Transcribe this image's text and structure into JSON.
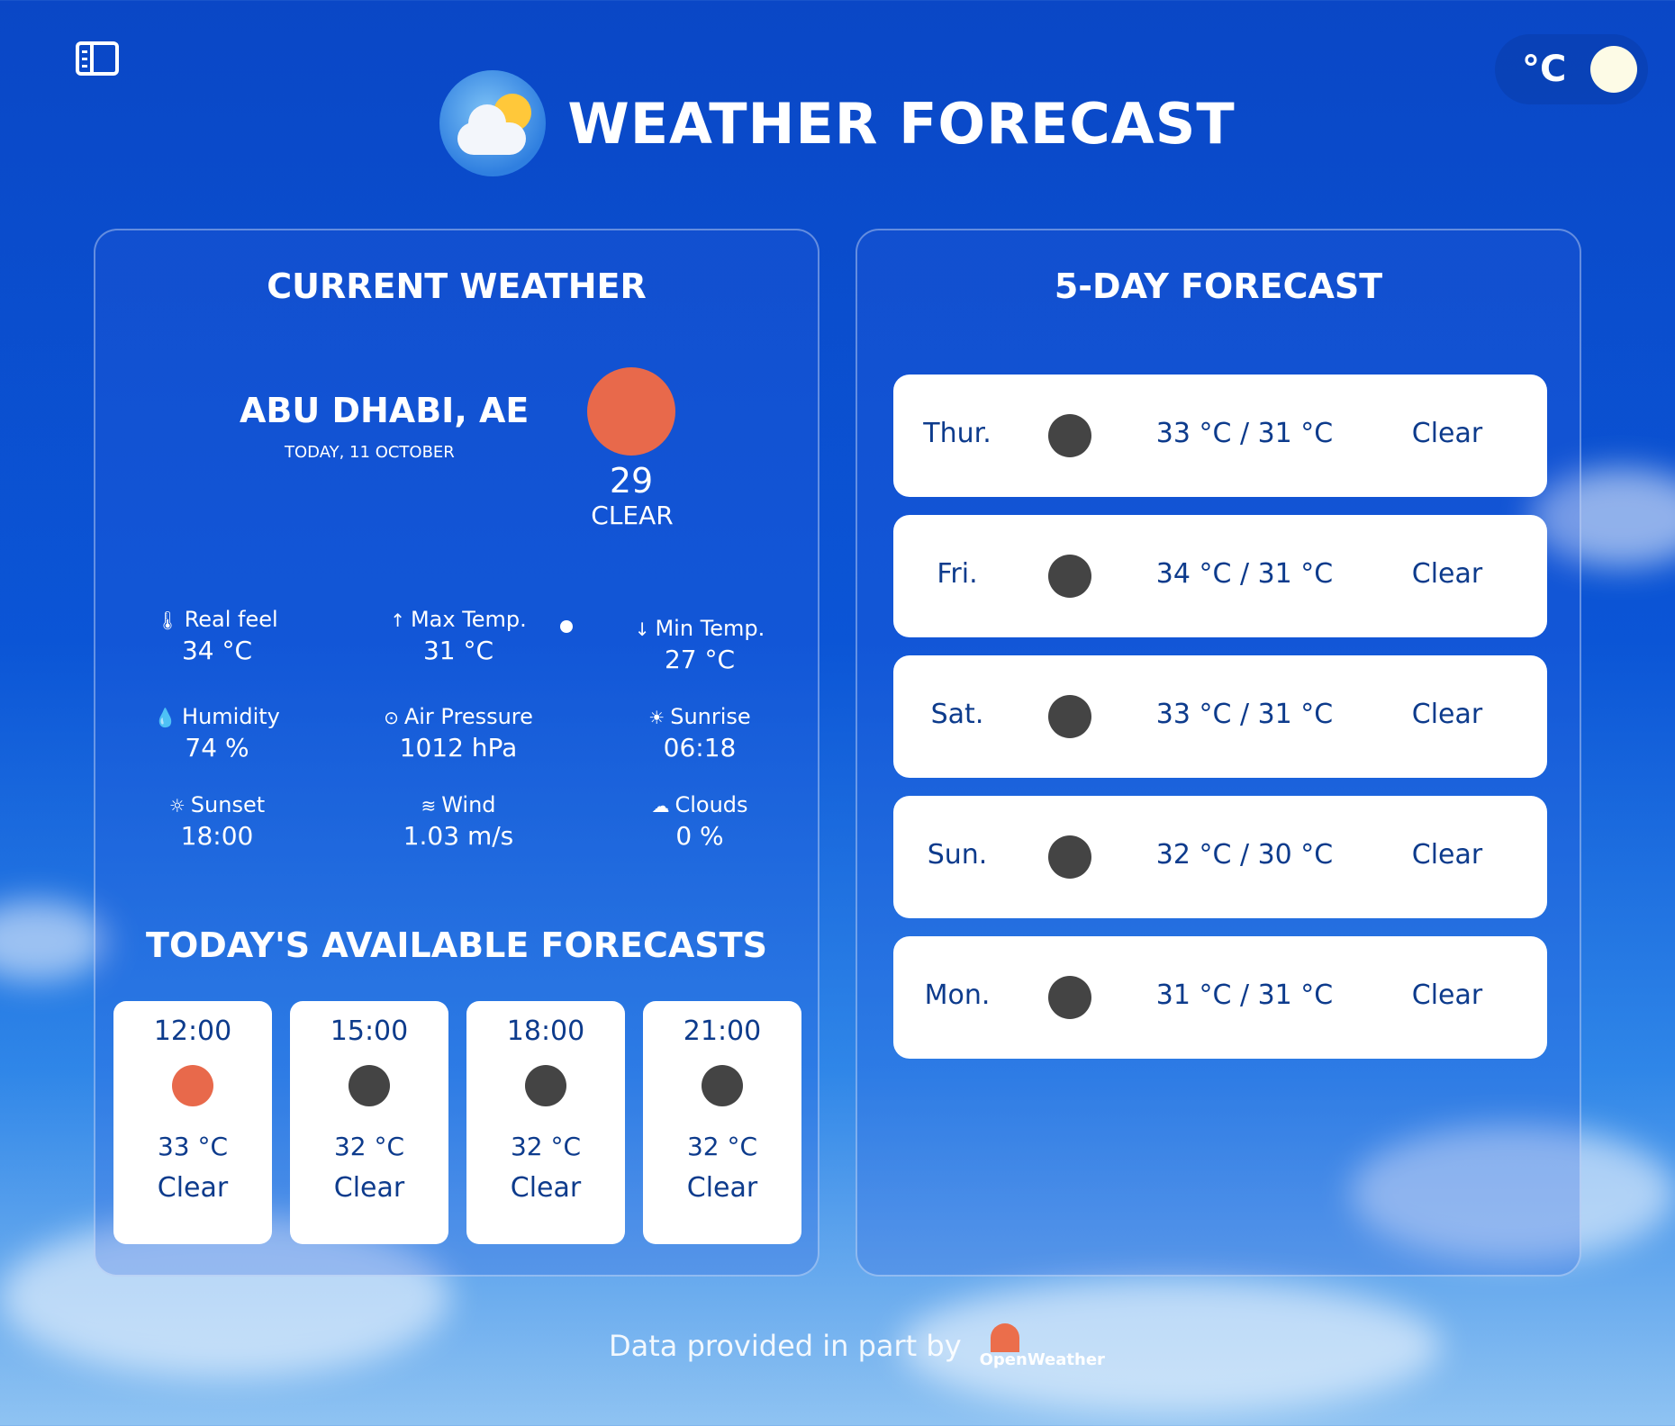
{
  "header": {
    "title": "WEATHER FORECAST",
    "unit_label": "°C"
  },
  "current": {
    "title": "CURRENT WEATHER",
    "city": "ABU DHABI, AE",
    "date": "TODAY, 11 OCTOBER",
    "temp": "29",
    "condition": "CLEAR",
    "icon_color": "#e8694b",
    "stats": [
      {
        "label": "Real feel",
        "value": "34 °C",
        "icon": "thermometer-icon"
      },
      {
        "label": "Max Temp.",
        "value": "31 °C",
        "icon": "max-temp-icon"
      },
      {
        "label": "Min Temp.",
        "value": "27 °C",
        "icon": "min-temp-icon"
      },
      {
        "label": "Humidity",
        "value": "74 %",
        "icon": "droplet-icon"
      },
      {
        "label": "Air Pressure",
        "value": "1012 hPa",
        "icon": "pressure-icon"
      },
      {
        "label": "Sunrise",
        "value": "06:18",
        "icon": "sunrise-icon"
      },
      {
        "label": "Sunset",
        "value": "18:00",
        "icon": "sunset-icon"
      },
      {
        "label": "Wind",
        "value": "1.03 m/s",
        "icon": "wind-icon"
      },
      {
        "label": "Clouds",
        "value": "0 %",
        "icon": "cloud-icon"
      }
    ]
  },
  "today": {
    "title": "TODAY'S AVAILABLE FORECASTS",
    "hours": [
      {
        "time": "12:00",
        "temp": "33 °C",
        "condition": "Clear",
        "icon_color": "#e8694b"
      },
      {
        "time": "15:00",
        "temp": "32 °C",
        "condition": "Clear",
        "icon_color": "#444444"
      },
      {
        "time": "18:00",
        "temp": "32 °C",
        "condition": "Clear",
        "icon_color": "#444444"
      },
      {
        "time": "21:00",
        "temp": "32 °C",
        "condition": "Clear",
        "icon_color": "#444444"
      }
    ]
  },
  "forecast": {
    "title": "5-DAY FORECAST",
    "days": [
      {
        "day": "Thur.",
        "temps": "33 °C / 31 °C",
        "condition": "Clear"
      },
      {
        "day": "Fri.",
        "temps": "34 °C / 31 °C",
        "condition": "Clear"
      },
      {
        "day": "Sat.",
        "temps": "33 °C / 31 °C",
        "condition": "Clear"
      },
      {
        "day": "Sun.",
        "temps": "32 °C / 30 °C",
        "condition": "Clear"
      },
      {
        "day": "Mon.",
        "temps": "31 °C / 31 °C",
        "condition": "Clear"
      }
    ]
  },
  "footer": {
    "text": "Data provided in part by",
    "brand": "OpenWeather"
  }
}
